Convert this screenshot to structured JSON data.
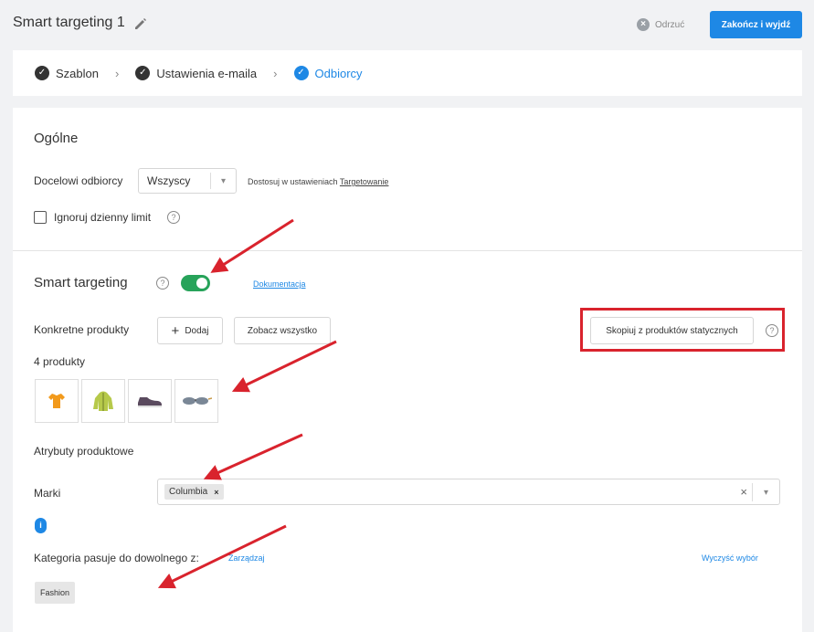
{
  "header": {
    "title": "Smart targeting 1",
    "discard_label": "Odrzuć",
    "finish_label": "Zakończ i wyjdź"
  },
  "steps": [
    {
      "label": "Szablon",
      "state": "done"
    },
    {
      "label": "Ustawienia e-maila",
      "state": "done"
    },
    {
      "label": "Odbiorcy",
      "state": "active"
    }
  ],
  "general": {
    "title": "Ogólne",
    "recipients_label": "Docelowi odbiorcy",
    "recipients_value": "Wszyscy",
    "adjust_text": "Dostosuj w ustawieniach",
    "adjust_link": "Targetowanie",
    "ignore_limit_label": "Ignoruj dzienny limit"
  },
  "smart": {
    "title": "Smart targeting",
    "enabled": true,
    "docs_link": "Dokumentacja",
    "products_label": "Konkretne produkty",
    "add_label": "Dodaj",
    "see_all_label": "Zobacz wszystko",
    "copy_label": "Skopiuj z produktów statycznych",
    "product_count": "4 produkty",
    "product_icons": [
      "tshirt-icon",
      "jacket-icon",
      "shoe-icon",
      "sunglasses-icon"
    ],
    "attributes_title": "Atrybuty produktowe",
    "brands_label": "Marki",
    "brand_tag": "Columbia",
    "info_badge": "i",
    "category_label": "Kategoria pasuje do dowolnego z:",
    "manage_link": "Zarządzaj",
    "clear_link": "Wyczyść wybór",
    "category_tag": "Fashion"
  },
  "colors": {
    "accent": "#1e88e5",
    "toggle_on": "#27a35a",
    "highlight": "#d9232d"
  }
}
